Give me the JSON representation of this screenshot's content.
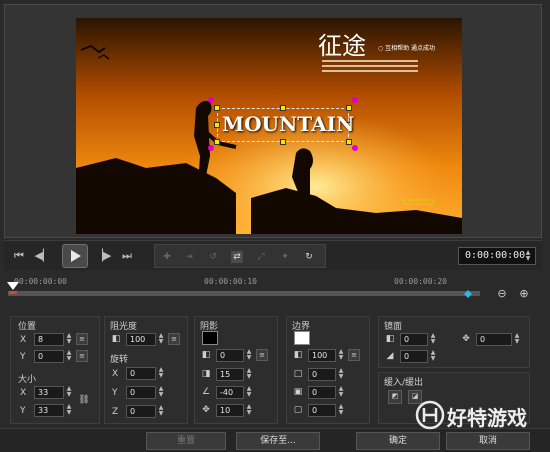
{
  "preview": {
    "title_cn": "征途",
    "title_small": "○ 互相帮助 通点成功",
    "overlay_text": "MOUNTAIN"
  },
  "transport": {
    "timecode": "0:00:00:00"
  },
  "ruler": {
    "ticks": [
      "00:00:00:00",
      "00:00:00:10",
      "00:00:00:20"
    ]
  },
  "panels": {
    "position": {
      "title": "位置",
      "x_label": "X",
      "x_value": "8",
      "y_label": "Y",
      "y_value": "0"
    },
    "size": {
      "title": "大小",
      "x_label": "X",
      "x_value": "33",
      "y_label": "Y",
      "y_value": "33"
    },
    "opacity": {
      "title": "阻光度",
      "value": "100"
    },
    "rotation": {
      "title": "旋转",
      "x_label": "X",
      "x_value": "0",
      "y_label": "Y",
      "y_value": "0",
      "z_label": "Z",
      "z_value": "0"
    },
    "shadow": {
      "title": "阴影",
      "color": "#000000",
      "opacity_value": "0",
      "blur_value": "15",
      "angle_value": "-40",
      "distance_value": "10"
    },
    "border": {
      "title": "边界",
      "color": "#ffffff",
      "opacity_value": "100",
      "v1": "0",
      "v2": "0",
      "v3": "0"
    },
    "mirror": {
      "title": "镜面",
      "v1": "0",
      "v2": "0",
      "v3": "0"
    },
    "fade": {
      "title": "缓入/缓出"
    }
  },
  "buttons": {
    "reset": "重置",
    "save_to": "保存至...",
    "ok": "确定",
    "cancel": "取消"
  },
  "watermark": {
    "text": "好特游戏"
  },
  "colors": {
    "accent_cyan": "#2fb5e6",
    "handle_yellow": "#f5e500",
    "rotate_magenta": "#e000c8"
  }
}
